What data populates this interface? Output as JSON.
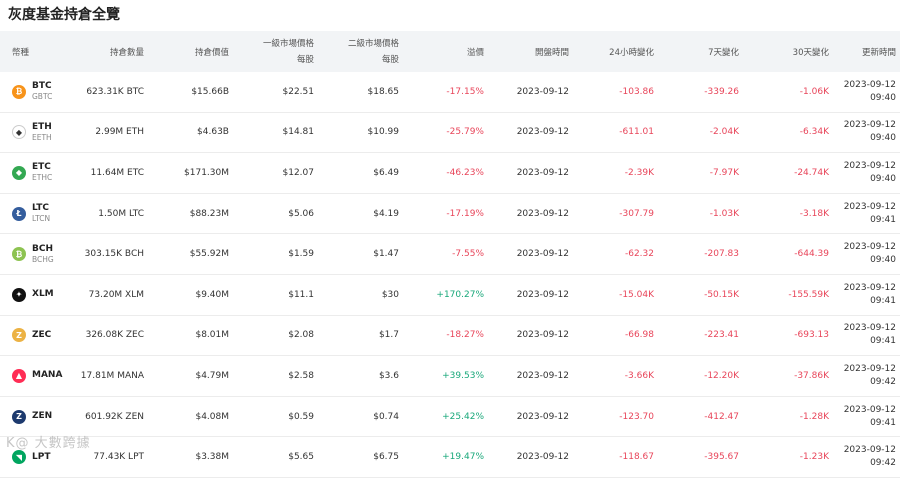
{
  "page_title": "灰度基金持倉全覽",
  "watermark": "K@ 大數跨據",
  "headers": [
    "幣種",
    "持倉數量",
    "持倉價值",
    "一級市場價格",
    "每股",
    "二級市場價格",
    "每股",
    "溢價",
    "開盤時間",
    "24小時變化",
    "7天變化",
    "30天變化",
    "更新時間"
  ],
  "colors": {
    "negative": "#e8455a",
    "positive": "#19a87a",
    "header_bg": "#f2f4f6"
  },
  "rows": [
    {
      "symbol": "BTC",
      "sub": "GBTC",
      "icon": "btc-icon",
      "icon_color": "#f7931a",
      "glyph": "₿",
      "amount": "623.31K BTC",
      "value": "$15.66B",
      "primary": "$22.51",
      "secondary": "$18.65",
      "premium": "-17.15%",
      "premium_sign": "neg",
      "open": "2023-09-12",
      "ch24": "-103.86",
      "ch7": "-339.26",
      "ch30": "-1.06K",
      "upd_date": "2023-09-12",
      "upd_time": "09:40"
    },
    {
      "symbol": "ETH",
      "sub": "EETH",
      "icon": "eth-icon",
      "icon_color": "#ffffff",
      "glyph": "◆",
      "amount": "2.99M ETH",
      "value": "$4.63B",
      "primary": "$14.81",
      "secondary": "$10.99",
      "premium": "-25.79%",
      "premium_sign": "neg",
      "open": "2023-09-12",
      "ch24": "-611.01",
      "ch7": "-2.04K",
      "ch30": "-6.34K",
      "upd_date": "2023-09-12",
      "upd_time": "09:40"
    },
    {
      "symbol": "ETC",
      "sub": "ETHC",
      "icon": "etc-icon",
      "icon_color": "#33a852",
      "glyph": "◆",
      "amount": "11.64M ETC",
      "value": "$171.30M",
      "primary": "$12.07",
      "secondary": "$6.49",
      "premium": "-46.23%",
      "premium_sign": "neg",
      "open": "2023-09-12",
      "ch24": "-2.39K",
      "ch7": "-7.97K",
      "ch30": "-24.74K",
      "upd_date": "2023-09-12",
      "upd_time": "09:40"
    },
    {
      "symbol": "LTC",
      "sub": "LTCN",
      "icon": "ltc-icon",
      "icon_color": "#345d9d",
      "glyph": "Ł",
      "amount": "1.50M LTC",
      "value": "$88.23M",
      "primary": "$5.06",
      "secondary": "$4.19",
      "premium": "-17.19%",
      "premium_sign": "neg",
      "open": "2023-09-12",
      "ch24": "-307.79",
      "ch7": "-1.03K",
      "ch30": "-3.18K",
      "upd_date": "2023-09-12",
      "upd_time": "09:41"
    },
    {
      "symbol": "BCH",
      "sub": "BCHG",
      "icon": "bch-icon",
      "icon_color": "#8dc351",
      "glyph": "₿",
      "amount": "303.15K BCH",
      "value": "$55.92M",
      "primary": "$1.59",
      "secondary": "$1.47",
      "premium": "-7.55%",
      "premium_sign": "neg",
      "open": "2023-09-12",
      "ch24": "-62.32",
      "ch7": "-207.83",
      "ch30": "-644.39",
      "upd_date": "2023-09-12",
      "upd_time": "09:40"
    },
    {
      "symbol": "XLM",
      "sub": "",
      "icon": "xlm-icon",
      "icon_color": "#111111",
      "glyph": "✦",
      "amount": "73.20M XLM",
      "value": "$9.40M",
      "primary": "$11.1",
      "secondary": "$30",
      "premium": "+170.27%",
      "premium_sign": "pos",
      "open": "2023-09-12",
      "ch24": "-15.04K",
      "ch7": "-50.15K",
      "ch30": "-155.59K",
      "upd_date": "2023-09-12",
      "upd_time": "09:41"
    },
    {
      "symbol": "ZEC",
      "sub": "",
      "icon": "zec-icon",
      "icon_color": "#ecb244",
      "glyph": "Z",
      "amount": "326.08K ZEC",
      "value": "$8.01M",
      "primary": "$2.08",
      "secondary": "$1.7",
      "premium": "-18.27%",
      "premium_sign": "neg",
      "open": "2023-09-12",
      "ch24": "-66.98",
      "ch7": "-223.41",
      "ch30": "-693.13",
      "upd_date": "2023-09-12",
      "upd_time": "09:41"
    },
    {
      "symbol": "MANA",
      "sub": "",
      "icon": "mana-icon",
      "icon_color": "#ff2d55",
      "glyph": "▲",
      "amount": "17.81M MANA",
      "value": "$4.79M",
      "primary": "$2.58",
      "secondary": "$3.6",
      "premium": "+39.53%",
      "premium_sign": "pos",
      "open": "2023-09-12",
      "ch24": "-3.66K",
      "ch7": "-12.20K",
      "ch30": "-37.86K",
      "upd_date": "2023-09-12",
      "upd_time": "09:42"
    },
    {
      "symbol": "ZEN",
      "sub": "",
      "icon": "zen-icon",
      "icon_color": "#1d3a6e",
      "glyph": "Z",
      "amount": "601.92K ZEN",
      "value": "$4.08M",
      "primary": "$0.59",
      "secondary": "$0.74",
      "premium": "+25.42%",
      "premium_sign": "pos",
      "open": "2023-09-12",
      "ch24": "-123.70",
      "ch7": "-412.47",
      "ch30": "-1.28K",
      "upd_date": "2023-09-12",
      "upd_time": "09:41"
    },
    {
      "symbol": "LPT",
      "sub": "",
      "icon": "lpt-icon",
      "icon_color": "#00a55f",
      "glyph": "◥",
      "amount": "77.43K LPT",
      "value": "$3.38M",
      "primary": "$5.65",
      "secondary": "$6.75",
      "premium": "+19.47%",
      "premium_sign": "pos",
      "open": "2023-09-12",
      "ch24": "-118.67",
      "ch7": "-395.67",
      "ch30": "-1.23K",
      "upd_date": "2023-09-12",
      "upd_time": "09:42"
    }
  ]
}
